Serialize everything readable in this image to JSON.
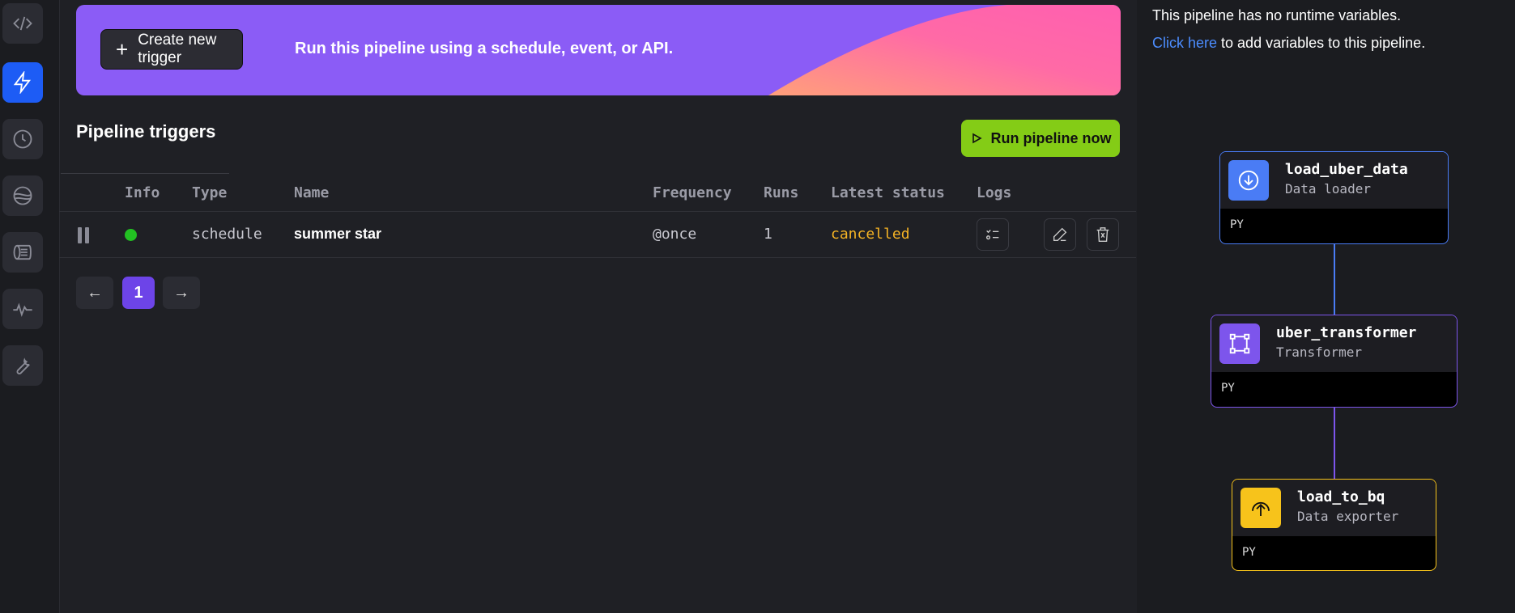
{
  "nav": {
    "items": [
      {
        "name": "code-icon",
        "active": false
      },
      {
        "name": "lightning-icon",
        "active": true
      },
      {
        "name": "clock-icon",
        "active": false
      },
      {
        "name": "globe-icon",
        "active": false
      },
      {
        "name": "logs-icon",
        "active": false
      },
      {
        "name": "monitor-icon",
        "active": false
      },
      {
        "name": "wrench-icon",
        "active": false
      }
    ]
  },
  "banner": {
    "create_label": "Create new trigger",
    "text": "Run this pipeline using a schedule, event, or API."
  },
  "triggers": {
    "title": "Pipeline triggers",
    "run_now_label": "Run pipeline now",
    "columns": [
      "Info",
      "Type",
      "Name",
      "Frequency",
      "Runs",
      "Latest status",
      "Logs"
    ],
    "rows": [
      {
        "type": "schedule",
        "name": "summer star",
        "frequency": "@once",
        "runs": "1",
        "latest_status": "cancelled",
        "info_color": "#22c022",
        "status_color": "#f5b324"
      }
    ]
  },
  "pagination": {
    "prev": "←",
    "current": "1",
    "next": "→"
  },
  "variables": {
    "empty_text": "This pipeline has no runtime variables.",
    "link_text": "Click here",
    "link_suffix": " to add variables to this pipeline."
  },
  "blocks": [
    {
      "name": "load_uber_data",
      "type": "Data loader",
      "lang": "PY",
      "color": "#4a7cf5",
      "icon": "download-icon"
    },
    {
      "name": "uber_transformer",
      "type": "Transformer",
      "lang": "PY",
      "color": "#7d55ec",
      "icon": "transform-icon"
    },
    {
      "name": "load_to_bq",
      "type": "Data exporter",
      "lang": "PY",
      "color": "#f7c31b",
      "icon": "upload-icon"
    }
  ],
  "colors": {
    "accent_blue": "#1d5cf5",
    "run_green": "#84cc16",
    "banner_purple": "#8b5cf6",
    "banner_pink": "#ff5fa8",
    "link": "#4c8dff"
  }
}
